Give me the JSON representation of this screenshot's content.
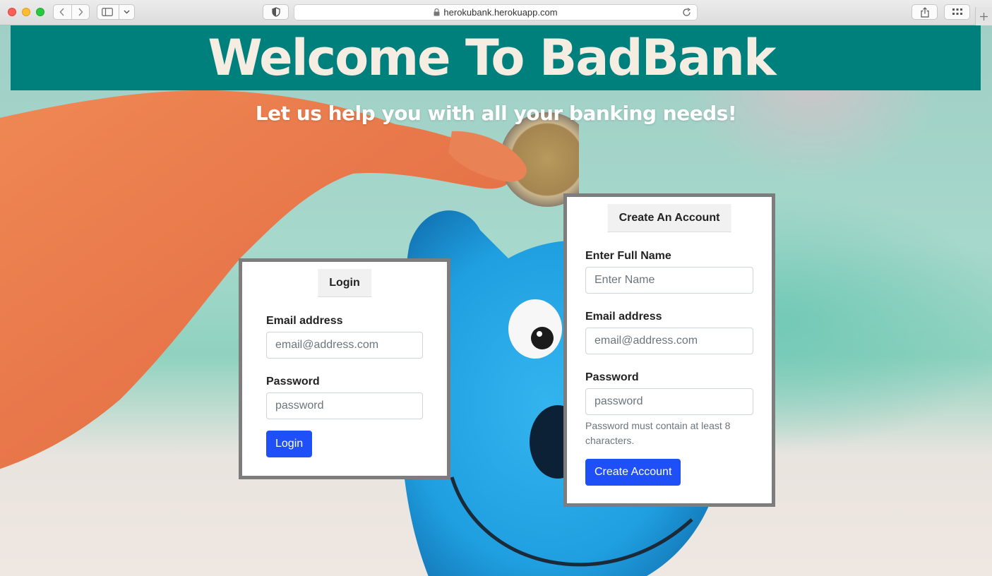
{
  "browser": {
    "url": "herokubank.herokuapp.com"
  },
  "header": {
    "title": "Welcome To BadBank",
    "tagline": "Let us help you with all your banking needs!"
  },
  "login_card": {
    "tab_label": "Login",
    "email_label": "Email address",
    "email_placeholder": "email@address.com",
    "password_label": "Password",
    "password_placeholder": "password",
    "submit_label": "Login"
  },
  "create_card": {
    "tab_label": "Create An Account",
    "name_label": "Enter Full Name",
    "name_placeholder": "Enter Name",
    "email_label": "Email address",
    "email_placeholder": "email@address.com",
    "password_label": "Password",
    "password_placeholder": "password",
    "password_help": "Password must contain at least 8 characters.",
    "submit_label": "Create Account"
  },
  "colors": {
    "banner": "#00807c",
    "title_text": "#f5ece2",
    "primary_button": "#1f4ff7",
    "card_border": "#7d7d7d"
  }
}
